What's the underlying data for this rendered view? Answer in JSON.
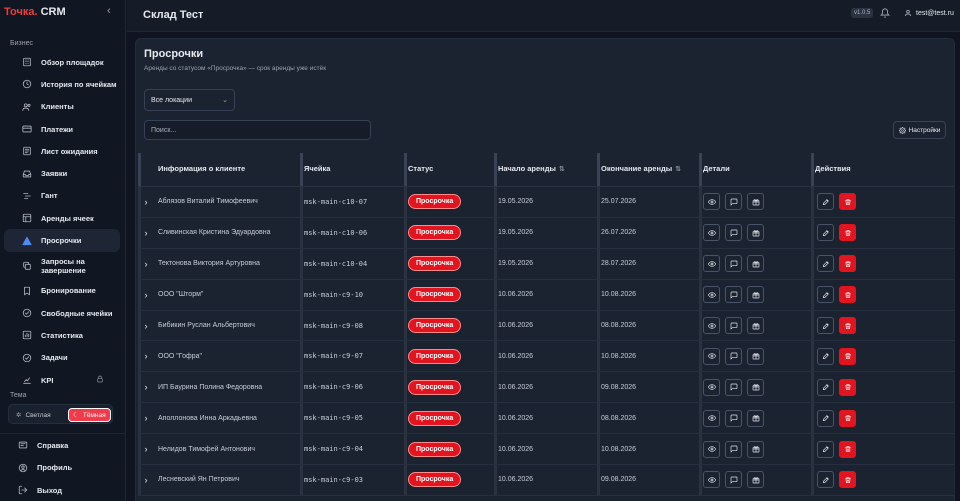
{
  "sidebar": {
    "brand_prefix": "Точка.",
    "brand_suffix": " CRM",
    "section_business": "Бизнес",
    "items": [
      {
        "label": "Обзор площадок",
        "icon": "building-icon"
      },
      {
        "label": "История по ячейкам",
        "icon": "history-icon"
      },
      {
        "label": "Клиенты",
        "icon": "users-icon"
      },
      {
        "label": "Платежи",
        "icon": "credit-card-icon"
      },
      {
        "label": "Лист ожидания",
        "icon": "list-icon"
      },
      {
        "label": "Заявки",
        "icon": "inbox-icon"
      },
      {
        "label": "Гант",
        "icon": "gantt-icon"
      },
      {
        "label": "Аренды ячеек",
        "icon": "grid-icon"
      },
      {
        "label": "Просрочки",
        "icon": "warning-icon",
        "active": true
      },
      {
        "label": "Запросы на завершение",
        "icon": "copy-icon"
      },
      {
        "label": "Бронирование",
        "icon": "bookmark-icon"
      },
      {
        "label": "Свободные ячейки",
        "icon": "check-circle-icon"
      },
      {
        "label": "Статистика",
        "icon": "chart-icon"
      },
      {
        "label": "Задачи",
        "icon": "task-icon"
      },
      {
        "label": "KPI",
        "icon": "kpi-icon",
        "locked": true
      }
    ],
    "section_theme": "Тема",
    "theme_light": "Светлая",
    "theme_dark": "Тёмная",
    "bottom_items": [
      {
        "label": "Справка",
        "icon": "help-icon"
      },
      {
        "label": "Профиль",
        "icon": "profile-icon"
      },
      {
        "label": "Выход",
        "icon": "logout-icon"
      }
    ]
  },
  "header": {
    "title": "Склад Тест",
    "version": "v1.0.5",
    "user": "test@test.ru"
  },
  "main": {
    "title": "Просрочки",
    "subtitle": "Аренды со статусом «Просрочка» — срок аренды уже истёк",
    "location_select": "Все локации",
    "search_placeholder": "Поиск...",
    "settings_label": "Настройки",
    "columns": [
      "Информация о клиенте",
      "Ячейка",
      "Статус",
      "Начало аренды",
      "Окончание аренды",
      "Детали",
      "Действия"
    ],
    "rows": [
      {
        "client": "Аблязов Виталий Тимофеевич",
        "cell": "msk-main-c10-07",
        "status": "Просрочка",
        "start": "19.05.2026",
        "end": "25.07.2026"
      },
      {
        "client": "Сливинская Кристина Эдуардовна",
        "cell": "msk-main-c10-06",
        "status": "Просрочка",
        "start": "19.05.2026",
        "end": "26.07.2026"
      },
      {
        "client": "Тектонова Виктория Артуровна",
        "cell": "msk-main-c10-04",
        "status": "Просрочка",
        "start": "19.05.2026",
        "end": "28.07.2026"
      },
      {
        "client": "ООО \"Шторм\"",
        "cell": "msk-main-c9-10",
        "status": "Просрочка",
        "start": "10.06.2026",
        "end": "10.08.2026"
      },
      {
        "client": "Бибикин Руслан Альбертович",
        "cell": "msk-main-c9-08",
        "status": "Просрочка",
        "start": "10.06.2026",
        "end": "08.08.2026"
      },
      {
        "client": "ООО \"Гофра\"",
        "cell": "msk-main-c9-07",
        "status": "Просрочка",
        "start": "10.06.2026",
        "end": "10.08.2026"
      },
      {
        "client": "ИП Баурина Полина Федоровна",
        "cell": "msk-main-c9-06",
        "status": "Просрочка",
        "start": "10.06.2026",
        "end": "09.08.2026"
      },
      {
        "client": "Аполлонова Инна Аркадьевна",
        "cell": "msk-main-c9-05",
        "status": "Просрочка",
        "start": "10.06.2026",
        "end": "08.08.2026"
      },
      {
        "client": "Нелидов Тимофей Антонович",
        "cell": "msk-main-c9-04",
        "status": "Просрочка",
        "start": "10.06.2026",
        "end": "10.08.2026"
      },
      {
        "client": "Лесневский Ян Петрович",
        "cell": "msk-main-c9-03",
        "status": "Просрочка",
        "start": "10.06.2026",
        "end": "09.08.2026"
      }
    ]
  },
  "colors": {
    "accent_red": "#e1141f",
    "active_blue": "#4b8cf5",
    "background": "#0f1420",
    "panel": "#1b2230"
  }
}
